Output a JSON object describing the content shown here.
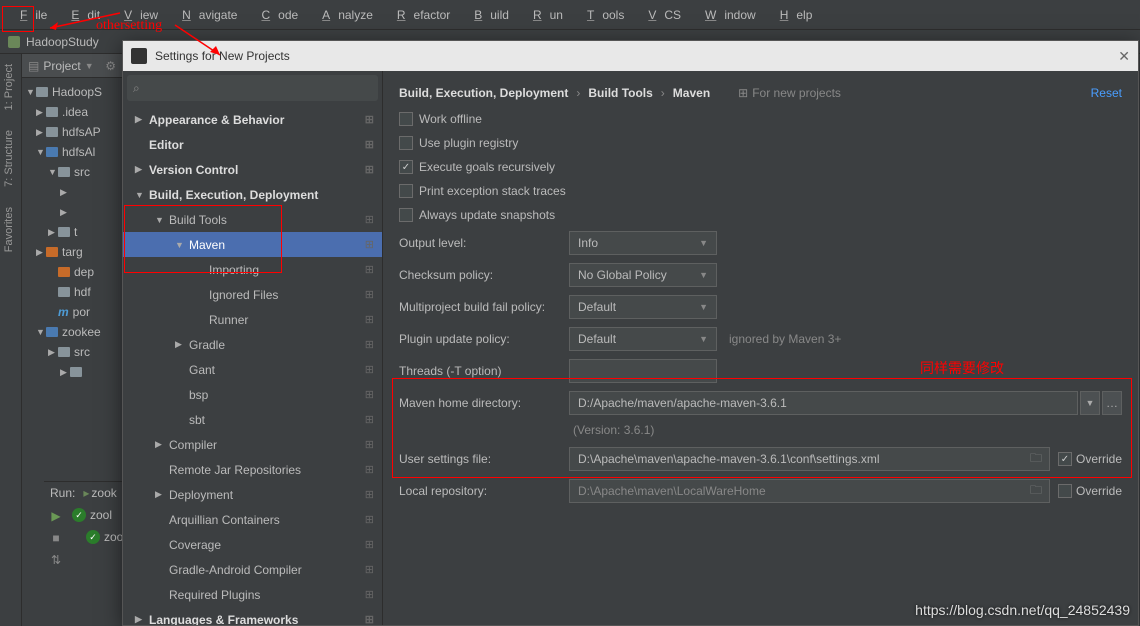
{
  "menu": [
    "File",
    "Edit",
    "View",
    "Navigate",
    "Code",
    "Analyze",
    "Refactor",
    "Build",
    "Run",
    "Tools",
    "VCS",
    "Window",
    "Help"
  ],
  "nav_project": "HadoopStudy",
  "proj_title": "Project",
  "left_tabs": [
    "1: Project",
    "7: Structure",
    "Favorites"
  ],
  "tree": [
    {
      "d": 0,
      "arrow": "▼",
      "icon": "folder",
      "name": "HadoopS"
    },
    {
      "d": 1,
      "arrow": "▶",
      "icon": "folder",
      "name": ".idea"
    },
    {
      "d": 1,
      "arrow": "▶",
      "icon": "folder",
      "name": "hdfsAP"
    },
    {
      "d": 1,
      "arrow": "▼",
      "icon": "folder-blue",
      "name": "hdfsAl"
    },
    {
      "d": 2,
      "arrow": "▼",
      "icon": "folder",
      "name": "src"
    },
    {
      "d": 3,
      "arrow": "▶",
      "icon": "",
      "name": ""
    },
    {
      "d": 3,
      "arrow": "▶",
      "icon": "",
      "name": ""
    },
    {
      "d": 2,
      "arrow": "▶",
      "icon": "folder",
      "name": "t"
    },
    {
      "d": 1,
      "arrow": "▶",
      "icon": "folder-orange",
      "name": "targ"
    },
    {
      "d": 2,
      "arrow": "",
      "icon": "folder-orange",
      "name": "dep"
    },
    {
      "d": 2,
      "arrow": "",
      "icon": "folder",
      "name": "hdf"
    },
    {
      "d": 2,
      "arrow": "",
      "icon": "m",
      "name": "por"
    },
    {
      "d": 1,
      "arrow": "▼",
      "icon": "folder-blue",
      "name": "zookee"
    },
    {
      "d": 2,
      "arrow": "▶",
      "icon": "folder",
      "name": "src"
    },
    {
      "d": 3,
      "arrow": "▶",
      "icon": "folder",
      "name": ""
    }
  ],
  "run": {
    "label": "Run:",
    "target": "zook",
    "items": [
      "zool",
      "zool"
    ]
  },
  "dialog_title": "Settings for New Projects",
  "search_placeholder": "",
  "search_icon": "⌕",
  "settings_tree": [
    {
      "d": 0,
      "arrow": "▶",
      "label": "Appearance & Behavior",
      "badge": "⊞"
    },
    {
      "d": 0,
      "arrow": "",
      "label": "Editor",
      "badge": "⊞"
    },
    {
      "d": 0,
      "arrow": "▶",
      "label": "Version Control",
      "badge": "⊞"
    },
    {
      "d": 0,
      "arrow": "▼",
      "label": "Build, Execution, Deployment",
      "badge": ""
    },
    {
      "d": 1,
      "arrow": "▼",
      "label": "Build Tools",
      "badge": "⊞"
    },
    {
      "d": 2,
      "arrow": "▼",
      "label": "Maven",
      "badge": "⊞",
      "sel": true
    },
    {
      "d": 3,
      "arrow": "",
      "label": "Importing",
      "badge": "⊞"
    },
    {
      "d": 3,
      "arrow": "",
      "label": "Ignored Files",
      "badge": "⊞"
    },
    {
      "d": 3,
      "arrow": "",
      "label": "Runner",
      "badge": "⊞"
    },
    {
      "d": 2,
      "arrow": "▶",
      "label": "Gradle",
      "badge": "⊞"
    },
    {
      "d": 2,
      "arrow": "",
      "label": "Gant",
      "badge": "⊞"
    },
    {
      "d": 2,
      "arrow": "",
      "label": "bsp",
      "badge": "⊞"
    },
    {
      "d": 2,
      "arrow": "",
      "label": "sbt",
      "badge": "⊞"
    },
    {
      "d": 1,
      "arrow": "▶",
      "label": "Compiler",
      "badge": "⊞"
    },
    {
      "d": 1,
      "arrow": "",
      "label": "Remote Jar Repositories",
      "badge": "⊞"
    },
    {
      "d": 1,
      "arrow": "▶",
      "label": "Deployment",
      "badge": "⊞"
    },
    {
      "d": 1,
      "arrow": "",
      "label": "Arquillian Containers",
      "badge": "⊞"
    },
    {
      "d": 1,
      "arrow": "",
      "label": "Coverage",
      "badge": "⊞"
    },
    {
      "d": 1,
      "arrow": "",
      "label": "Gradle-Android Compiler",
      "badge": "⊞"
    },
    {
      "d": 1,
      "arrow": "",
      "label": "Required Plugins",
      "badge": "⊞"
    },
    {
      "d": 0,
      "arrow": "▶",
      "label": "Languages & Frameworks",
      "badge": "⊞"
    }
  ],
  "breadcrumb": [
    "Build, Execution, Deployment",
    "Build Tools",
    "Maven"
  ],
  "for_new": "For new projects",
  "reset": "Reset",
  "checkboxes": [
    {
      "label": "Work offline",
      "checked": false
    },
    {
      "label": "Use plugin registry",
      "checked": false
    },
    {
      "label": "Execute goals recursively",
      "checked": true
    },
    {
      "label": "Print exception stack traces",
      "checked": false
    },
    {
      "label": "Always update snapshots",
      "checked": false
    }
  ],
  "rows": {
    "output_level": {
      "label": "Output level:",
      "value": "Info"
    },
    "checksum": {
      "label": "Checksum policy:",
      "value": "No Global Policy"
    },
    "multiproj": {
      "label": "Multiproject build fail policy:",
      "value": "Default"
    },
    "plugin_update": {
      "label": "Plugin update policy:",
      "value": "Default",
      "note": "ignored by Maven 3+"
    },
    "threads": {
      "label": "Threads (-T option)",
      "value": ""
    },
    "maven_home": {
      "label": "Maven home directory:",
      "value": "D:/Apache/maven/apache-maven-3.6.1"
    },
    "version": "(Version: 3.6.1)",
    "user_settings": {
      "label": "User settings file:",
      "value": "D:\\Apache\\maven\\apache-maven-3.6.1\\conf\\settings.xml",
      "override": true,
      "olabel": "Override"
    },
    "local_repo": {
      "label": "Local repository:",
      "value": "D:\\Apache\\maven\\LocalWareHome",
      "override": false,
      "olabel": "Override"
    }
  },
  "annotations": {
    "top1": "othersetting",
    "cn": "同样需要修改"
  },
  "watermark": "https://blog.csdn.net/qq_24852439"
}
